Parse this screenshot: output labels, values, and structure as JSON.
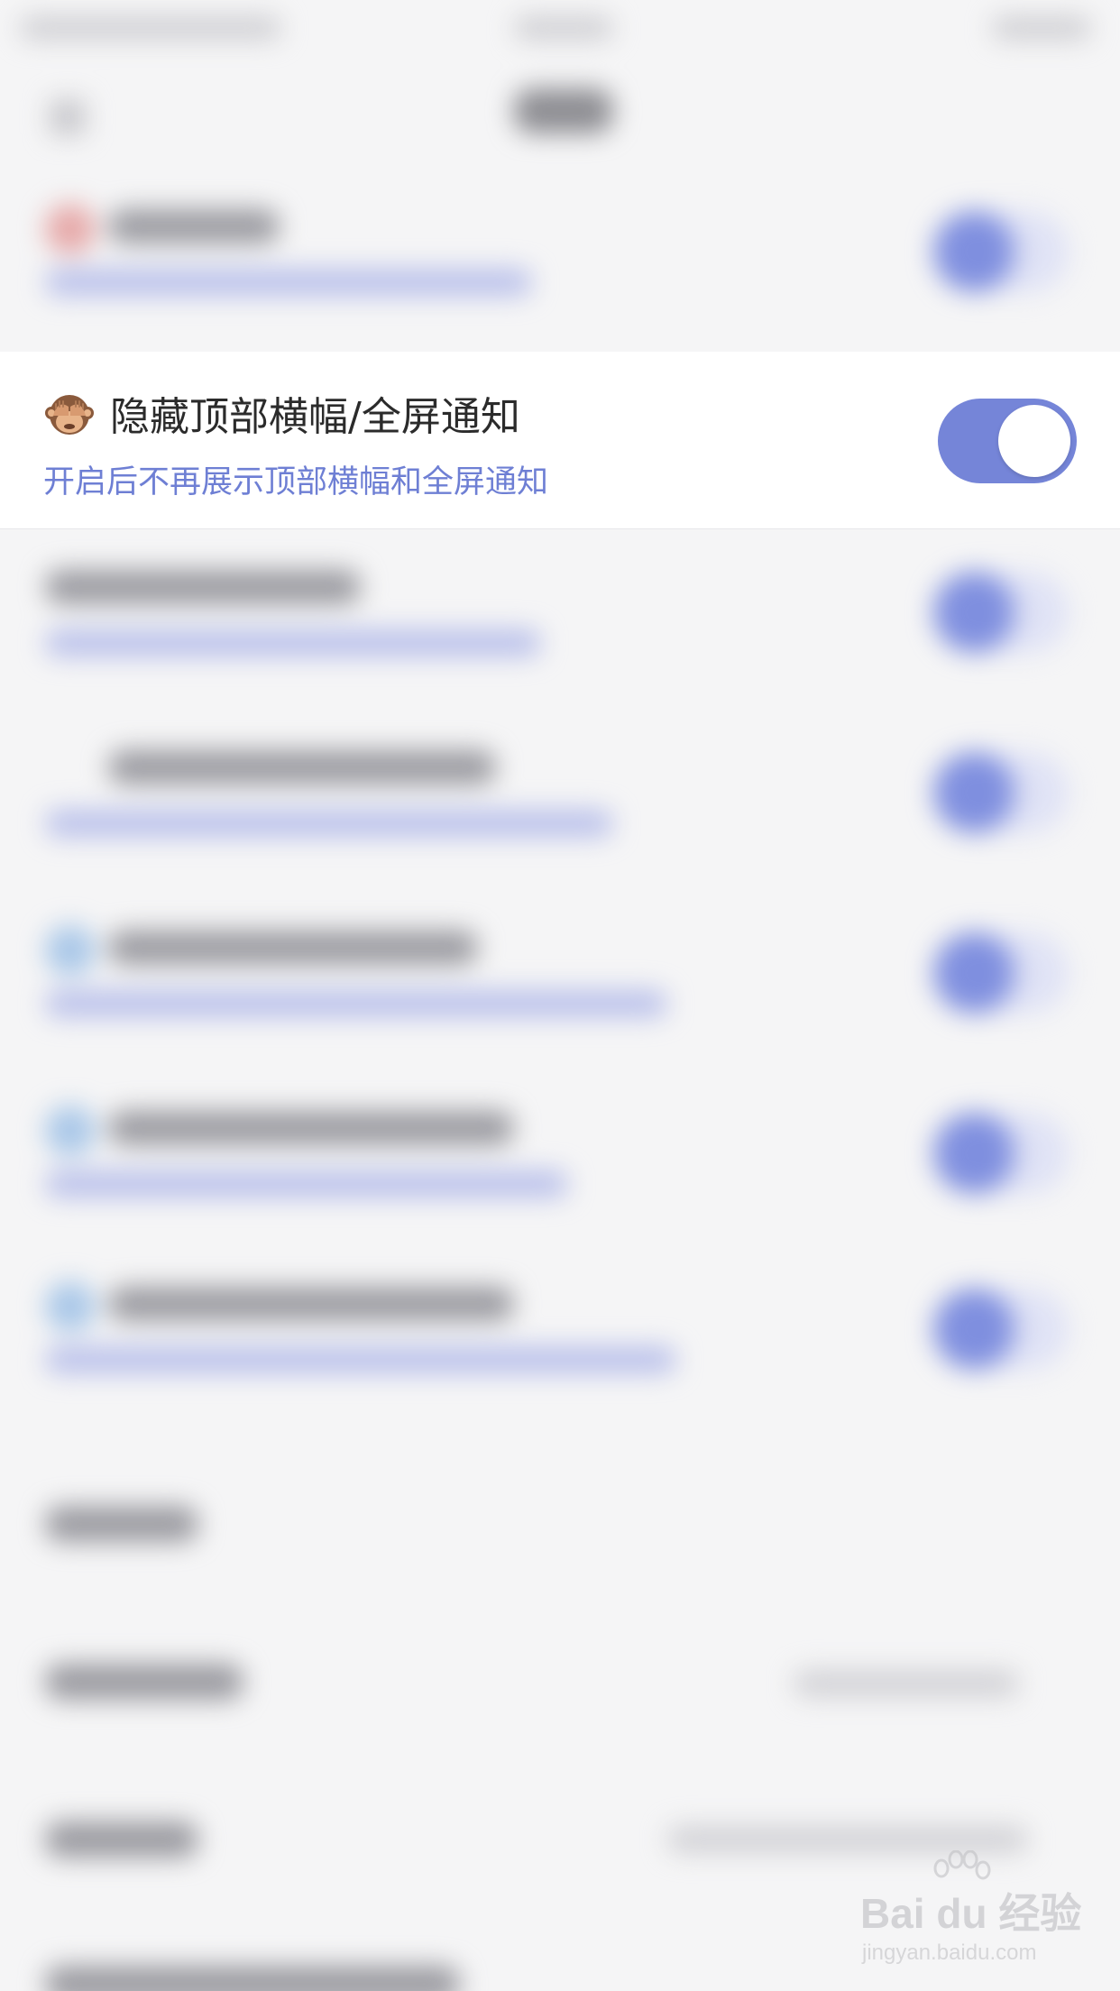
{
  "focused_setting": {
    "emoji_icon": "see-no-evil-monkey",
    "title": "隐藏顶部横幅/全屏通知",
    "subtitle": "开启后不再展示顶部横幅和全屏通知",
    "toggle_on": true
  },
  "colors": {
    "accent": "#7585d8",
    "subtitle_text": "#6e7fd4",
    "title_text": "#2b2b2b",
    "background": "#f5f5f6",
    "row_background": "#ffffff"
  },
  "watermark": {
    "brand": "Bai du 经验",
    "url": "jingyan.baidu.com"
  }
}
